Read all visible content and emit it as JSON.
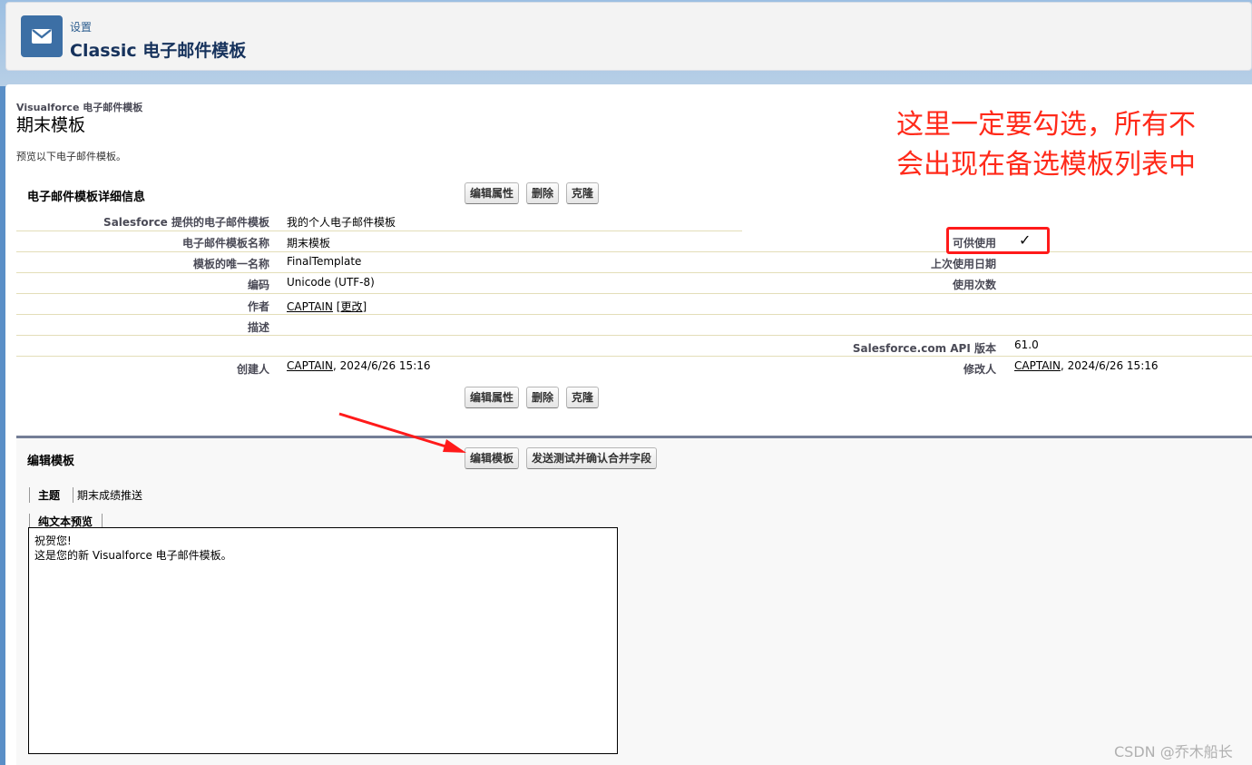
{
  "header": {
    "breadcrumb": "设置",
    "title": "Classic 电子邮件模板"
  },
  "record": {
    "type_label": "Visualforce 电子邮件模板",
    "name": "期末模板",
    "preview_note": "预览以下电子邮件模板。"
  },
  "details": {
    "section_title": "电子邮件模板详细信息",
    "buttons": {
      "edit_props": "编辑属性",
      "delete": "删除",
      "clone": "克隆"
    },
    "fields": {
      "folder_label": "Salesforce 提供的电子邮件模板",
      "folder_value": "我的个人电子邮件模板",
      "name_label": "电子邮件模板名称",
      "name_value": "期末模板",
      "available_label": "可供使用",
      "available_value": "✓",
      "unique_label": "模板的唯一名称",
      "unique_value": "FinalTemplate",
      "last_used_label": "上次使用日期",
      "encoding_label": "编码",
      "encoding_value": "Unicode (UTF-8)",
      "times_used_label": "使用次数",
      "author_label": "作者",
      "author_value": "CAPTAIN",
      "author_change": "[更改]",
      "desc_label": "描述",
      "api_label": "Salesforce.com API 版本",
      "api_value": "61.0",
      "created_label": "创建人",
      "created_by": "CAPTAIN",
      "created_date": ", 2024/6/26 15:16",
      "modified_label": "修改人",
      "modified_by": "CAPTAIN",
      "modified_date": ", 2024/6/26 15:16"
    }
  },
  "edit_template": {
    "section_title": "编辑模板",
    "edit_button": "编辑模板",
    "send_test_button": "发送测试并确认合并字段",
    "subject_label": "主题",
    "subject_value": "期末成绩推送",
    "preview_tab": "纯文本预览",
    "preview_line1": "祝贺您!",
    "preview_line2": "这是您的新 Visualforce 电子邮件模板。"
  },
  "annotation": {
    "text": "这里一定要勾选，所有不会出现在备选模板列表中"
  },
  "watermark": "CSDN @乔木船长",
  "colors": {
    "annotation": "#ff2a1a",
    "header_icon": "#3c6fa5",
    "section_border": "#747e96"
  }
}
